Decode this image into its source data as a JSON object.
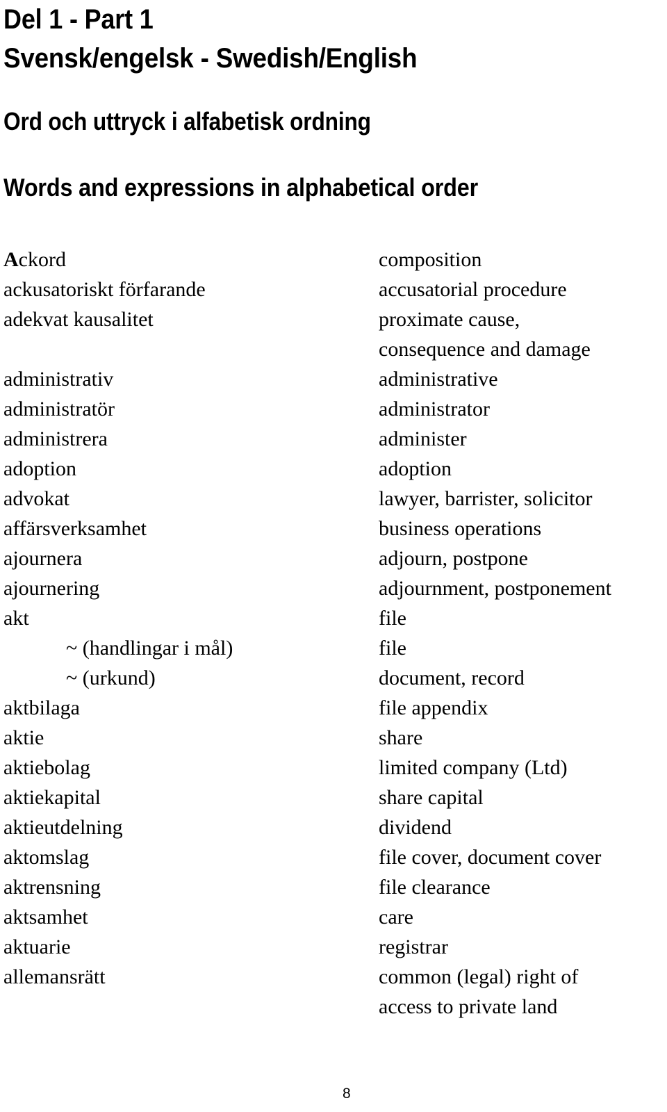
{
  "document": {
    "page_number": "8"
  },
  "headings": {
    "part": "Del 1 - Part 1",
    "languages": "Svensk/engelsk - Swedish/English",
    "subtitle_sv": "Ord och uttryck i alfabetisk ordning",
    "subtitle_en": "Words and expressions in alphabetical order"
  },
  "glossary": {
    "rows": [
      {
        "sv_initial": "A",
        "sv_rest": "ckord",
        "sv": "Ackord",
        "en": "composition",
        "indent": false
      },
      {
        "sv": "ackusatoriskt förfarande",
        "en": "accusatorial procedure",
        "indent": false
      },
      {
        "sv": "adekvat kausalitet",
        "en": "proximate cause,",
        "indent": false
      },
      {
        "sv": "",
        "en": "consequence and damage",
        "indent": false
      },
      {
        "sv": "administrativ",
        "en": "administrative",
        "indent": false
      },
      {
        "sv": "administratör",
        "en": "administrator",
        "indent": false
      },
      {
        "sv": "administrera",
        "en": "administer",
        "indent": false
      },
      {
        "sv": "adoption",
        "en": "adoption",
        "indent": false
      },
      {
        "sv": "advokat",
        "en": "lawyer, barrister, solicitor",
        "indent": false
      },
      {
        "sv": "affärsverksamhet",
        "en": "business operations",
        "indent": false
      },
      {
        "sv": "ajournera",
        "en": "adjourn, postpone",
        "indent": false
      },
      {
        "sv": "ajournering",
        "en": "adjournment, postponement",
        "indent": false
      },
      {
        "sv": "akt",
        "en": "file",
        "indent": false
      },
      {
        "sv": "~  (handlingar i mål)",
        "en": "file",
        "indent": true
      },
      {
        "sv": "~  (urkund)",
        "en": "document, record",
        "indent": true
      },
      {
        "sv": "aktbilaga",
        "en": "file appendix",
        "indent": false
      },
      {
        "sv": "aktie",
        "en": "share",
        "indent": false
      },
      {
        "sv": "aktiebolag",
        "en": "limited company (Ltd)",
        "indent": false
      },
      {
        "sv": "aktiekapital",
        "en": "share capital",
        "indent": false
      },
      {
        "sv": "aktieutdelning",
        "en": "dividend",
        "indent": false
      },
      {
        "sv": "aktomslag",
        "en": "file cover, document cover",
        "indent": false
      },
      {
        "sv": "aktrensning",
        "en": "file clearance",
        "indent": false
      },
      {
        "sv": "aktsamhet",
        "en": "care",
        "indent": false
      },
      {
        "sv": "aktuarie",
        "en": "registrar",
        "indent": false
      },
      {
        "sv": "allemansrätt",
        "en": "common (legal) right of",
        "indent": false
      },
      {
        "sv": "",
        "en": "access to private land",
        "indent": false
      }
    ]
  }
}
